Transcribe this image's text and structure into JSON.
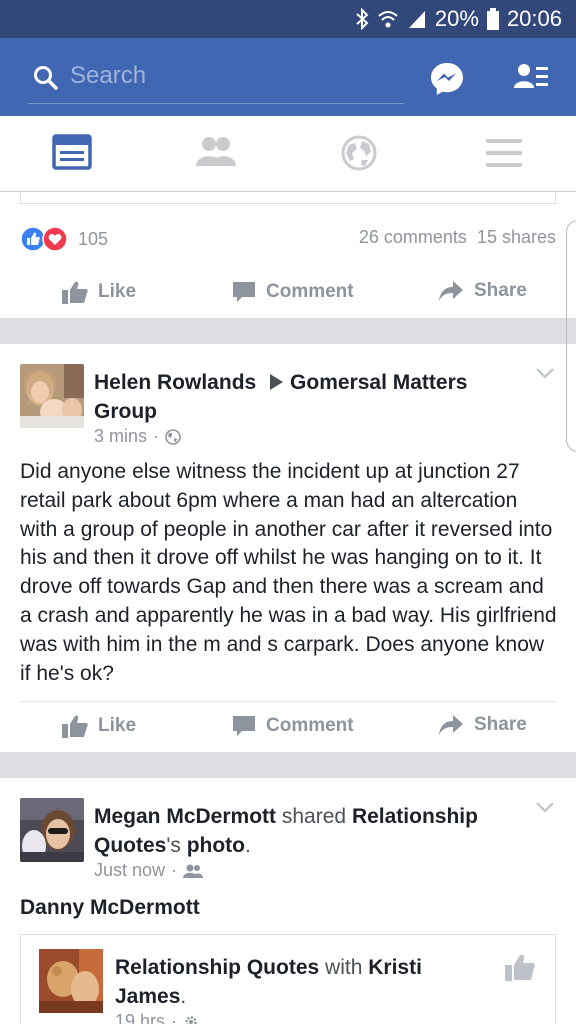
{
  "status_bar": {
    "battery_text": "20%",
    "time": "20:06"
  },
  "search_bar": {
    "placeholder": "Search"
  },
  "tabs": [
    {
      "icon": "news-feed-icon",
      "active": true
    },
    {
      "icon": "friends-icon",
      "active": false
    },
    {
      "icon": "globe-icon",
      "active": false
    },
    {
      "icon": "menu-icon",
      "active": false
    }
  ],
  "post1": {
    "reaction_count": "105",
    "comments_shares": "26 comments  15 shares"
  },
  "actions": {
    "like": "Like",
    "comment": "Comment",
    "share": "Share"
  },
  "post2": {
    "author": "Helen Rowlands",
    "group": "Gomersal Matters Group",
    "time": "3 mins",
    "privacy_icon": "globe-icon",
    "text": "Did anyone else witness the incident up at junction 27 retail park about 6pm where a man had an altercation with a group of people in another car after it reversed into his and then it drove off whilst he was hanging on to it. It drove off towards Gap and then there was a scream and a crash and apparently he was in a bad way. His girlfriend was with him in the m and s carpark. Does anyone know if he's ok?"
  },
  "post3": {
    "author": "Megan McDermott",
    "verb": "shared",
    "page": "Relationship Quotes",
    "possessive": "'s",
    "object": "photo",
    "end": ".",
    "time": "Just now",
    "privacy_icon": "friends-icon",
    "tagged": "Danny McDermott",
    "shared": {
      "page": "Relationship Quotes",
      "with": "with",
      "person": "Kristi James",
      "end": ".",
      "time": "19 hrs"
    }
  },
  "colors": {
    "status_bar": "#33487a",
    "header": "#4267b2",
    "active_tab": "#4267b2",
    "like_blue": "#3b7ff5",
    "love_red": "#f23b4e"
  }
}
